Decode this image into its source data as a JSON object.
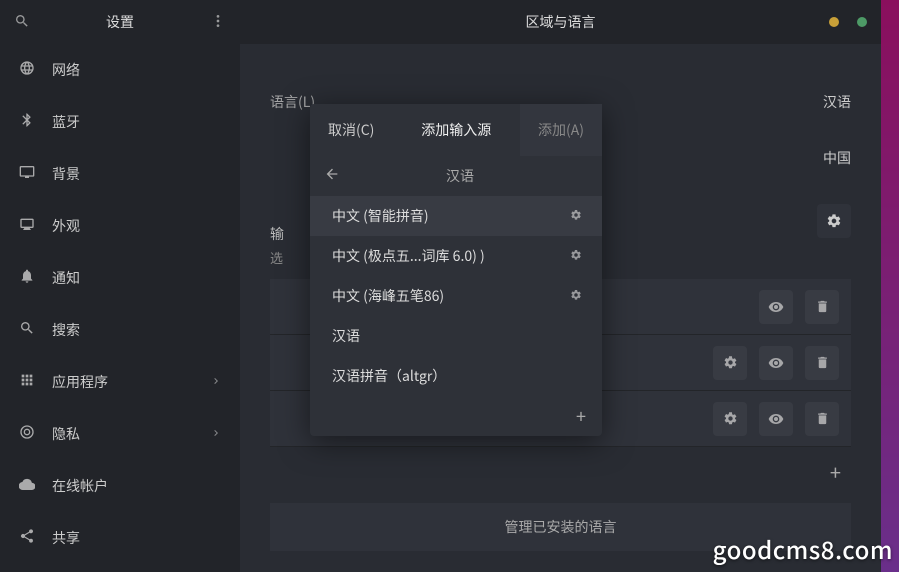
{
  "sidebar": {
    "title": "设置",
    "items": [
      {
        "label": "网络",
        "icon": "globe"
      },
      {
        "label": "蓝牙",
        "icon": "bluetooth"
      },
      {
        "label": "背景",
        "icon": "monitor"
      },
      {
        "label": "外观",
        "icon": "display"
      },
      {
        "label": "通知",
        "icon": "bell"
      },
      {
        "label": "搜索",
        "icon": "search"
      },
      {
        "label": "应用程序",
        "icon": "apps",
        "chevron": true
      },
      {
        "label": "隐私",
        "icon": "target",
        "chevron": true
      },
      {
        "label": "在线帐户",
        "icon": "cloud"
      },
      {
        "label": "共享",
        "icon": "share"
      }
    ]
  },
  "header": {
    "title": "区域与语言"
  },
  "settings": {
    "language_label": "语言(L)",
    "language_value": "汉语",
    "region_value": "中国",
    "input_label": "输",
    "input_sub": "选"
  },
  "input_rows": [
    {
      "gear": false,
      "eye": true,
      "trash": true
    },
    {
      "gear": true,
      "eye": true,
      "trash": true
    },
    {
      "gear": true,
      "eye": true,
      "trash": true
    }
  ],
  "manage_label": "管理已安装的语言",
  "dialog": {
    "cancel": "取消(C)",
    "title": "添加输入源",
    "add": "添加(A)",
    "lang_header": "汉语",
    "items": [
      {
        "label": "中文 (智能拼音)",
        "cog": true,
        "selected": true
      },
      {
        "label": "中文 (极点五...词库 6.0)  )",
        "cog": true
      },
      {
        "label": "中文 (海峰五笔86)",
        "cog": true
      },
      {
        "label": "汉语"
      },
      {
        "label": "汉语拼音（altgr）"
      }
    ]
  },
  "watermark": "goodcms8.com"
}
